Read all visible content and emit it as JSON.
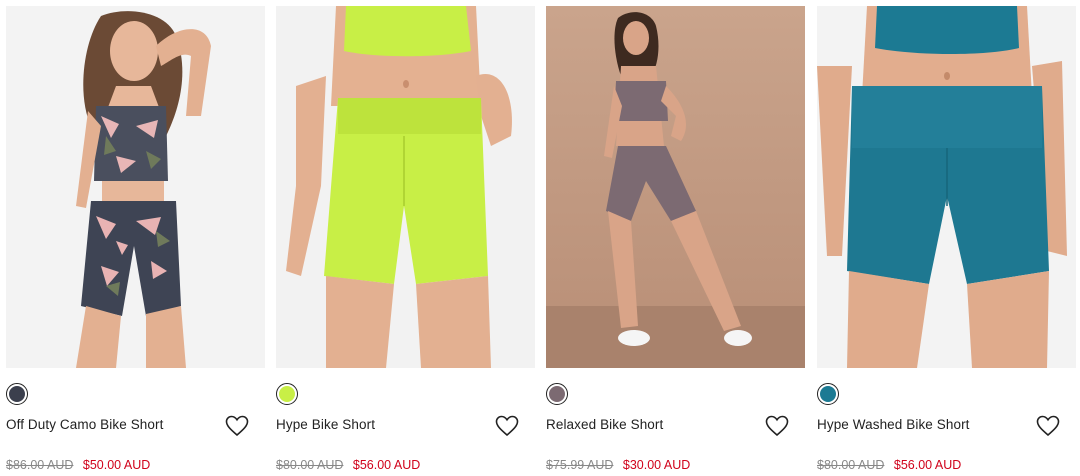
{
  "colors": {
    "sale": "#d0021b",
    "strike": "#888888"
  },
  "products": [
    {
      "name": "Off Duty Camo Bike Short",
      "was": "$86.00 AUD",
      "now": "$50.00 AUD",
      "swatch": "#3b3f4d",
      "wish_icon": "heart-outline-icon"
    },
    {
      "name": "Hype Bike Short",
      "was": "$80.00 AUD",
      "now": "$56.00 AUD",
      "swatch": "#c8ef46",
      "wish_icon": "heart-outline-icon"
    },
    {
      "name": "Relaxed Bike Short",
      "was": "$75.99 AUD",
      "now": "$30.00 AUD",
      "swatch": "#7c6a72",
      "wish_icon": "heart-outline-icon"
    },
    {
      "name": "Hype Washed Bike Short",
      "was": "$80.00 AUD",
      "now": "$56.00 AUD",
      "swatch": "#1c7a93",
      "wish_icon": "heart-outline-icon"
    }
  ]
}
